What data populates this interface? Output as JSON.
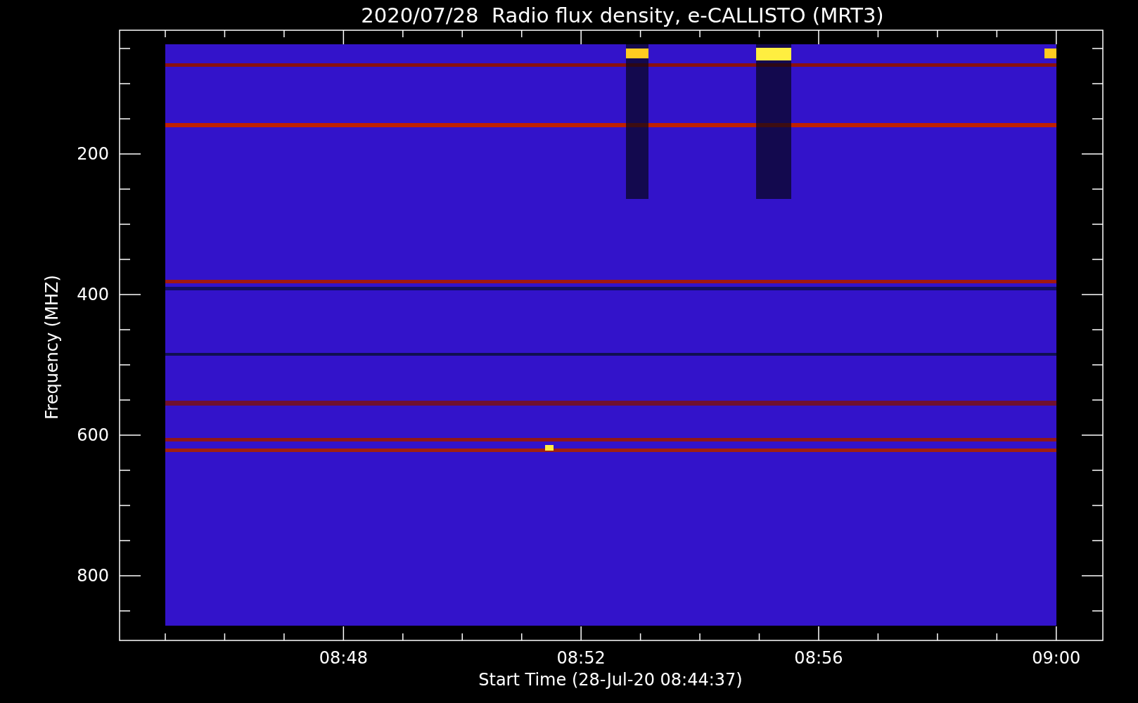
{
  "title": "2020/07/28  Radio flux density, e-CALLISTO (MRT3)",
  "y_axis": {
    "label": "Frequency (MHZ)",
    "tick_labels": [
      "200",
      "400",
      "600",
      "800"
    ]
  },
  "x_axis": {
    "label": "Start Time (28-Jul-20 08:44:37)",
    "tick_labels": [
      "08:48",
      "08:52",
      "08:56",
      "09:00"
    ]
  }
}
